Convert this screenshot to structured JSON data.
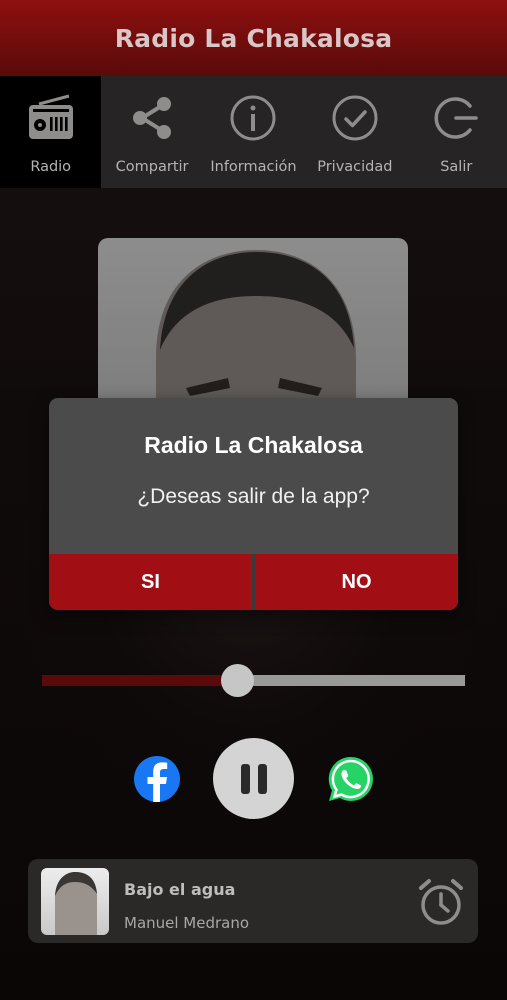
{
  "app": {
    "title": "Radio La Chakalosa"
  },
  "nav": {
    "items": [
      {
        "label": "Radio",
        "icon": "radio-icon",
        "active": true
      },
      {
        "label": "Compartir",
        "icon": "share-icon",
        "active": false
      },
      {
        "label": "Información",
        "icon": "info-icon",
        "active": false
      },
      {
        "label": "Privacidad",
        "icon": "check-circle-icon",
        "active": false
      },
      {
        "label": "Salir",
        "icon": "exit-icon",
        "active": false
      }
    ]
  },
  "dialog": {
    "title": "Radio La Chakalosa",
    "message": "¿Deseas salir de la app?",
    "yes_label": "SI",
    "no_label": "NO"
  },
  "player": {
    "volume_fraction": 0.46,
    "state": "playing",
    "now_playing": {
      "song": "Bajo el agua",
      "artist": "Manuel Medrano"
    }
  },
  "colors": {
    "brand_red": "#a10f14",
    "title_gradient_top": "#8e1010",
    "nav_background": "#262424",
    "dialog_background": "#4b4b4b",
    "facebook_blue": "#1877f2",
    "whatsapp_green": "#25d366"
  }
}
